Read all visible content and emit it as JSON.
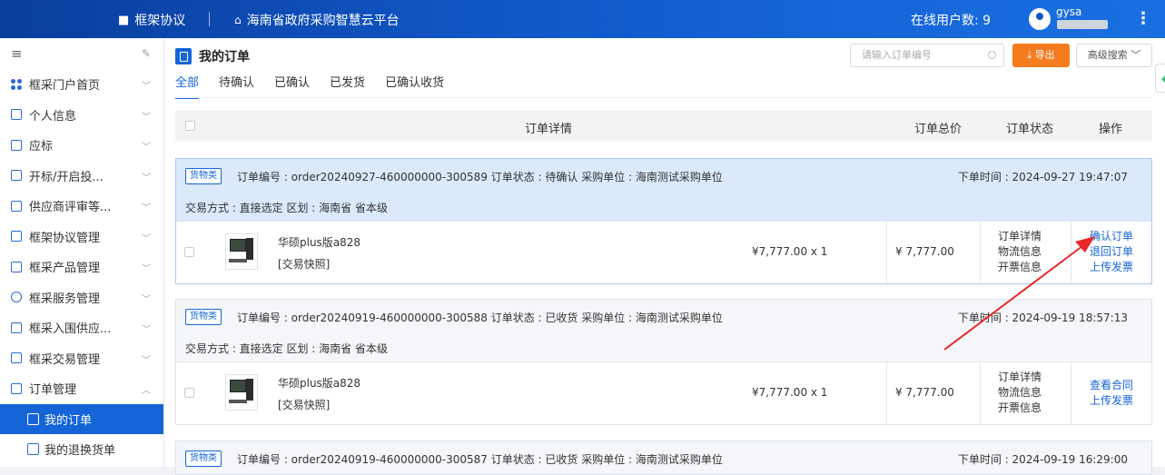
{
  "topbar": {
    "section": "框架协议",
    "platform": "海南省政府采购智慧云平台",
    "online_label": "在线用户数: 9",
    "user": "gysa",
    "more": "⋮"
  },
  "sidebar": {
    "menu_icon": "≡",
    "pin_icon": "✎",
    "items": [
      {
        "label": "框采门户首页",
        "chev": "﹀"
      },
      {
        "label": "个人信息",
        "chev": "﹀"
      },
      {
        "label": "应标",
        "chev": "﹀"
      },
      {
        "label": "开标/开启投...",
        "chev": "﹀"
      },
      {
        "label": "供应商评审等...",
        "chev": "﹀"
      },
      {
        "label": "框架协议管理",
        "chev": "﹀"
      },
      {
        "label": "框采产品管理",
        "chev": "﹀"
      },
      {
        "label": "框采服务管理",
        "chev": "﹀"
      },
      {
        "label": "框采入围供应...",
        "chev": "﹀"
      },
      {
        "label": "框采交易管理",
        "chev": "﹀"
      },
      {
        "label": "订单管理",
        "chev": "︿"
      }
    ],
    "sub_items": [
      {
        "label": "我的订单"
      },
      {
        "label": "我的退换货单"
      }
    ]
  },
  "main": {
    "title": "我的订单",
    "search_placeholder": "请输入订单编号",
    "export_label": "⤓ 导出",
    "advanced_label": "高级搜索 ﹀",
    "tabs": [
      "全部",
      "待确认",
      "已确认",
      "已发货",
      "已确认收货"
    ],
    "columns": {
      "detail": "订单详情",
      "total": "订单总价",
      "status": "订单状态",
      "ops": "操作"
    }
  },
  "orders": [
    {
      "badge": "货物类",
      "info": "订单编号 : order20240927-460000000-300589   订单状态 : 待确认   采购单位 : 海南测试采购单位",
      "time": "下单时间 : 2024-09-27 19:47:07",
      "trade": "交易方式 : 直接选定    区划 : 海南省 省本级",
      "product": "华硕plus版a828",
      "snapshot": "[交易快照]",
      "unit_price": "¥7,777.00 x 1",
      "total": "¥ 7,777.00",
      "info_links": [
        "订单详情",
        "物流信息",
        "开票信息"
      ],
      "actions": [
        "确认订单",
        "退回订单",
        "上传发票"
      ]
    },
    {
      "badge": "货物类",
      "info": "订单编号 : order20240919-460000000-300588   订单状态 : 已收货   采购单位 : 海南测试采购单位",
      "time": "下单时间 : 2024-09-19 18:57:13",
      "trade": "交易方式 : 直接选定    区划 : 海南省 省本级",
      "product": "华硕plus版a828",
      "snapshot": "[交易快照]",
      "unit_price": "¥7,777.00 x 1",
      "total": "¥ 7,777.00",
      "info_links": [
        "订单详情",
        "物流信息",
        "开票信息"
      ],
      "actions": [
        "查看合同",
        "上传发票"
      ]
    },
    {
      "badge": "货物类",
      "info": "订单编号 : order20240919-460000000-300587   订单状态 : 已收货   采购单位 : 海南测试采购单位",
      "time": "下单时间 : 2024-09-19 16:29:00"
    }
  ]
}
